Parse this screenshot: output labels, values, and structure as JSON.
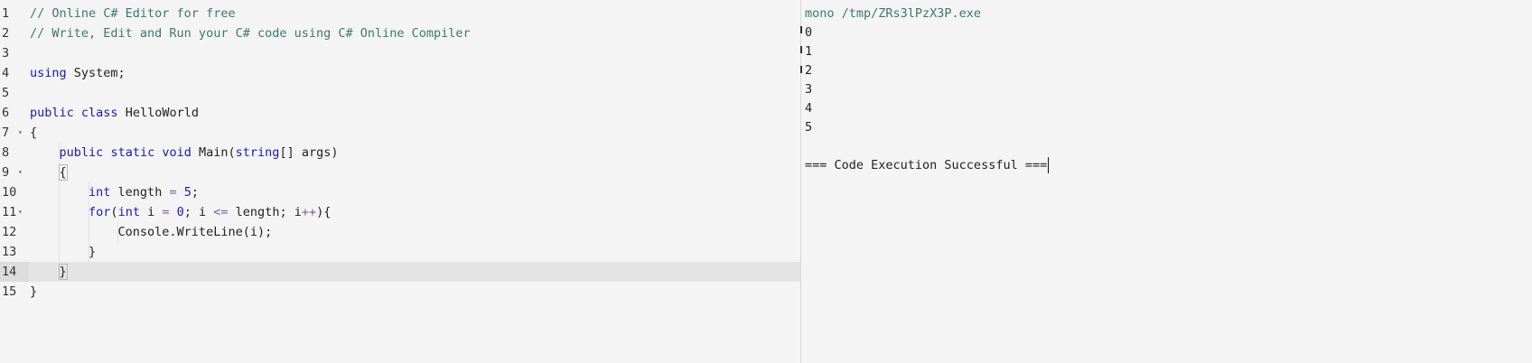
{
  "editor": {
    "lines": [
      {
        "num": "1",
        "tokens": [
          {
            "t": "// Online C# Editor for free",
            "c": "comment"
          }
        ]
      },
      {
        "num": "2",
        "tokens": [
          {
            "t": "// Write, Edit and Run your C# code using C# Online Compiler",
            "c": "comment"
          }
        ]
      },
      {
        "num": "3",
        "tokens": []
      },
      {
        "num": "4",
        "tokens": [
          {
            "t": "using",
            "c": "kw"
          },
          {
            "t": " System;",
            "c": "plain"
          }
        ]
      },
      {
        "num": "5",
        "tokens": []
      },
      {
        "num": "6",
        "tokens": [
          {
            "t": "public",
            "c": "kw"
          },
          {
            "t": " ",
            "c": "plain"
          },
          {
            "t": "class",
            "c": "kw"
          },
          {
            "t": " HelloWorld",
            "c": "plain"
          }
        ]
      },
      {
        "num": "7",
        "fold": "▾",
        "tokens": [
          {
            "t": "{",
            "c": "plain"
          }
        ]
      },
      {
        "num": "8",
        "tokens": [
          {
            "t": "    ",
            "c": "plain"
          },
          {
            "t": "public",
            "c": "kw"
          },
          {
            "t": " ",
            "c": "plain"
          },
          {
            "t": "static",
            "c": "kw"
          },
          {
            "t": " ",
            "c": "plain"
          },
          {
            "t": "void",
            "c": "kw"
          },
          {
            "t": " Main(",
            "c": "plain"
          },
          {
            "t": "string",
            "c": "type"
          },
          {
            "t": "[] args)",
            "c": "plain"
          }
        ]
      },
      {
        "num": "9",
        "fold": "▾",
        "tokens": [
          {
            "t": "    ",
            "c": "plain"
          },
          {
            "t": "{",
            "c": "plain",
            "match": true
          }
        ]
      },
      {
        "num": "10",
        "tokens": [
          {
            "t": "        ",
            "c": "plain"
          },
          {
            "t": "int",
            "c": "type"
          },
          {
            "t": " length ",
            "c": "plain"
          },
          {
            "t": "=",
            "c": "op"
          },
          {
            "t": " ",
            "c": "plain"
          },
          {
            "t": "5",
            "c": "num"
          },
          {
            "t": ";",
            "c": "plain"
          }
        ]
      },
      {
        "num": "11",
        "fold": "▾",
        "tokens": [
          {
            "t": "        ",
            "c": "plain"
          },
          {
            "t": "for",
            "c": "kw"
          },
          {
            "t": "(",
            "c": "plain"
          },
          {
            "t": "int",
            "c": "type"
          },
          {
            "t": " i ",
            "c": "plain"
          },
          {
            "t": "=",
            "c": "op"
          },
          {
            "t": " ",
            "c": "plain"
          },
          {
            "t": "0",
            "c": "num"
          },
          {
            "t": "; i ",
            "c": "plain"
          },
          {
            "t": "<=",
            "c": "op"
          },
          {
            "t": " length; i",
            "c": "plain"
          },
          {
            "t": "++",
            "c": "op"
          },
          {
            "t": "){",
            "c": "plain"
          }
        ]
      },
      {
        "num": "12",
        "tokens": [
          {
            "t": "            Console.WriteLine(i);",
            "c": "plain"
          }
        ]
      },
      {
        "num": "13",
        "tokens": [
          {
            "t": "        }",
            "c": "plain"
          }
        ]
      },
      {
        "num": "14",
        "active": true,
        "tokens": [
          {
            "t": "    ",
            "c": "plain"
          },
          {
            "t": "}",
            "c": "plain",
            "match": true
          }
        ]
      },
      {
        "num": "15",
        "tokens": [
          {
            "t": "}",
            "c": "plain"
          }
        ]
      }
    ]
  },
  "output": {
    "command": "mono /tmp/ZRs3lPzX3P.exe",
    "values": [
      "0",
      "1",
      "2",
      "3",
      "4",
      "5"
    ],
    "blank": "",
    "status": "=== Code Execution Successful ==="
  },
  "colors": {
    "comment": "#3a7a6c",
    "keyword": "#1a1ab0",
    "operator": "#7a5aa8",
    "background": "#f4f4f4",
    "active_line": "#e4e4e4"
  }
}
